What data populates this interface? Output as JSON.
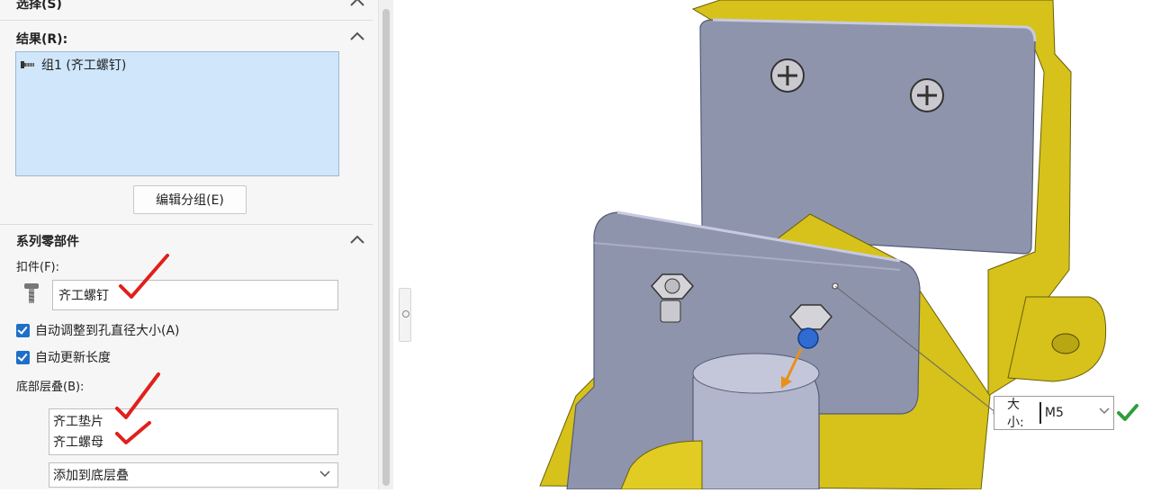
{
  "panel": {
    "selection_header": "选择(S)",
    "results_header": "结果(R):",
    "results_items": [
      {
        "label": "组1 (齐工螺钉)"
      }
    ],
    "edit_group_button": "编辑分组(E)",
    "series_header": "系列零部件",
    "fastener_label": "扣件(F):",
    "fastener_value": "齐工螺钉",
    "auto_size_label": "自动调整到孔直径大小(A)",
    "auto_size_checked": true,
    "auto_length_label": "自动更新长度",
    "auto_length_checked": true,
    "bottom_stack_label": "底部层叠(B):",
    "bottom_stack_items": [
      "齐工垫片",
      "齐工螺母"
    ],
    "add_to_stack_label": "添加到底层叠"
  },
  "callout": {
    "size_label": "大小:",
    "size_value": "M5"
  },
  "colors": {
    "list_selection": "#cfe6fb",
    "checkbox": "#1e6fc8",
    "annotation_red": "#e0201c",
    "part_yellow": "#d6c21a",
    "part_grey": "#8f94ad",
    "confirm_green": "#2e9e3a"
  },
  "icons": {
    "results_item": "fastener-group-icon",
    "fastener": "screw-icon",
    "collapse": "chevron-up-icon",
    "dropdown": "chevron-down-icon",
    "confirm": "checkmark-icon"
  }
}
